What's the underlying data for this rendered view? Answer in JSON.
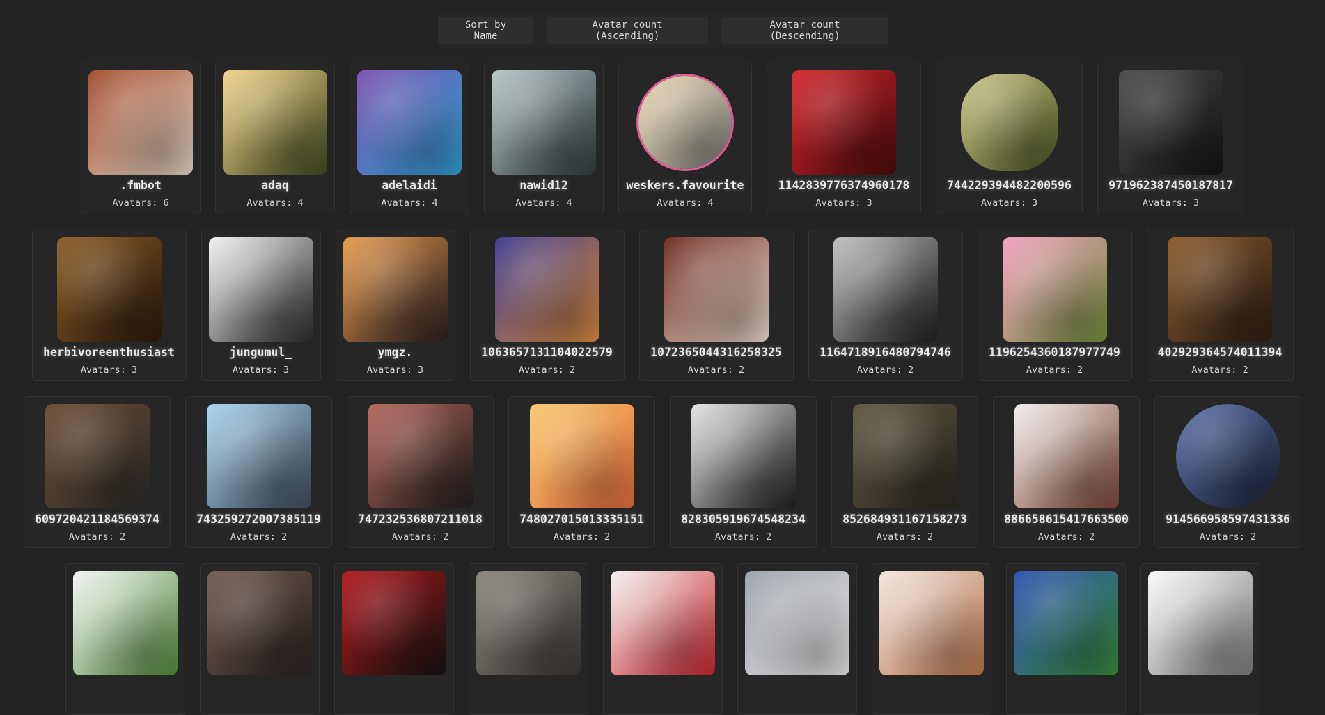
{
  "sort_buttons": [
    {
      "label": "Sort by Name"
    },
    {
      "label": "Avatar count (Ascending)"
    },
    {
      "label": "Avatar count (Descending)"
    }
  ],
  "count_prefix": "Avatars: ",
  "rows": [
    [
      {
        "name": ".fmbot",
        "count": 6,
        "colors": [
          "#a0492a",
          "#e3d7c6"
        ],
        "shape": "rounded"
      },
      {
        "name": "adaq",
        "count": 4,
        "colors": [
          "#f3d38a",
          "#3f4a1e"
        ],
        "shape": "rounded"
      },
      {
        "name": "adelaidi",
        "count": 4,
        "colors": [
          "#7a4fb0",
          "#2e9fd0"
        ],
        "shape": "rounded"
      },
      {
        "name": "nawid12",
        "count": 4,
        "colors": [
          "#b8c4c6",
          "#2f3a3e"
        ],
        "shape": "rounded"
      },
      {
        "name": "weskers.favourite",
        "count": 4,
        "colors": [
          "#e8d6b0",
          "#7d7d7d"
        ],
        "shape": "scallop"
      },
      {
        "name": "1142839776374960178",
        "count": 3,
        "colors": [
          "#d3262b",
          "#4a0b0c"
        ],
        "shape": "rounded"
      },
      {
        "name": "744229394482200596",
        "count": 3,
        "colors": [
          "#c9c48a",
          "#4b5520"
        ],
        "shape": "badge"
      },
      {
        "name": "971962387450187817",
        "count": 3,
        "colors": [
          "#4a4a4a",
          "#141414"
        ],
        "shape": "rounded"
      }
    ],
    [
      {
        "name": "herbivoreenthusiast",
        "count": 3,
        "colors": [
          "#8a5a24",
          "#2a1a0c"
        ],
        "shape": "rounded"
      },
      {
        "name": "jungumul_",
        "count": 3,
        "colors": [
          "#f2f2f2",
          "#2b2b2b"
        ],
        "shape": "rounded"
      },
      {
        "name": "ymgz.",
        "count": 3,
        "colors": [
          "#e79a4a",
          "#2a1e22"
        ],
        "shape": "rounded"
      },
      {
        "name": "1063657131104022579",
        "count": 2,
        "colors": [
          "#3b3a8f",
          "#d98a3a"
        ],
        "shape": "rounded"
      },
      {
        "name": "1072365044316258325",
        "count": 2,
        "colors": [
          "#6b2a1c",
          "#e9d9cf"
        ],
        "shape": "rounded"
      },
      {
        "name": "1164718916480794746",
        "count": 2,
        "colors": [
          "#bfbfbf",
          "#1e1e1e"
        ],
        "shape": "rounded"
      },
      {
        "name": "1196254360187977749",
        "count": 2,
        "colors": [
          "#f29fc0",
          "#6f8e3a"
        ],
        "shape": "rounded"
      },
      {
        "name": "402929364574011394",
        "count": 2,
        "colors": [
          "#8b5a2b",
          "#2a1d14"
        ],
        "shape": "rounded"
      }
    ],
    [
      {
        "name": "609720421184569374",
        "count": 2,
        "colors": [
          "#6a4a30",
          "#2c2c2c"
        ],
        "shape": "rounded"
      },
      {
        "name": "743259272007385119",
        "count": 2,
        "colors": [
          "#a7d3ef",
          "#3f4a57"
        ],
        "shape": "rounded"
      },
      {
        "name": "747232536807211018",
        "count": 2,
        "colors": [
          "#b5655a",
          "#1e1e1e"
        ],
        "shape": "rounded"
      },
      {
        "name": "748027015013335151",
        "count": 2,
        "colors": [
          "#f5c96e",
          "#e26a3a"
        ],
        "shape": "rounded"
      },
      {
        "name": "828305919674548234",
        "count": 2,
        "colors": [
          "#e4e4e4",
          "#1f1f1f"
        ],
        "shape": "rounded"
      },
      {
        "name": "852684931167158273",
        "count": 2,
        "colors": [
          "#5e5642",
          "#2b2620"
        ],
        "shape": "rounded"
      },
      {
        "name": "886658615417663500",
        "count": 2,
        "colors": [
          "#f1efee",
          "#7b4334"
        ],
        "shape": "rounded"
      },
      {
        "name": "914566958597431336",
        "count": 2,
        "colors": [
          "#5a6fa8",
          "#1c2236"
        ],
        "shape": "round"
      }
    ],
    [
      {
        "name": "",
        "count": null,
        "colors": [
          "#f4f4f4",
          "#4f8a3a"
        ],
        "shape": "rounded"
      },
      {
        "name": "",
        "count": null,
        "colors": [
          "#6e5a50",
          "#2a2220"
        ],
        "shape": "rounded"
      },
      {
        "name": "",
        "count": null,
        "colors": [
          "#b3161a",
          "#141414"
        ],
        "shape": "rounded"
      },
      {
        "name": "",
        "count": null,
        "colors": [
          "#8a847c",
          "#3a3633"
        ],
        "shape": "rounded"
      },
      {
        "name": "",
        "count": null,
        "colors": [
          "#f2f2f2",
          "#c8232b"
        ],
        "shape": "rounded"
      },
      {
        "name": "",
        "count": null,
        "colors": [
          "#9aa0a8",
          "#e4e4e4"
        ],
        "shape": "rounded"
      },
      {
        "name": "",
        "count": null,
        "colors": [
          "#f1e6e0",
          "#b9734a"
        ],
        "shape": "rounded"
      },
      {
        "name": "",
        "count": null,
        "colors": [
          "#2b4fb0",
          "#3a8a3a"
        ],
        "shape": "rounded"
      },
      {
        "name": "",
        "count": null,
        "colors": [
          "#fafafa",
          "#7a7a7a"
        ],
        "shape": "rounded"
      }
    ]
  ]
}
